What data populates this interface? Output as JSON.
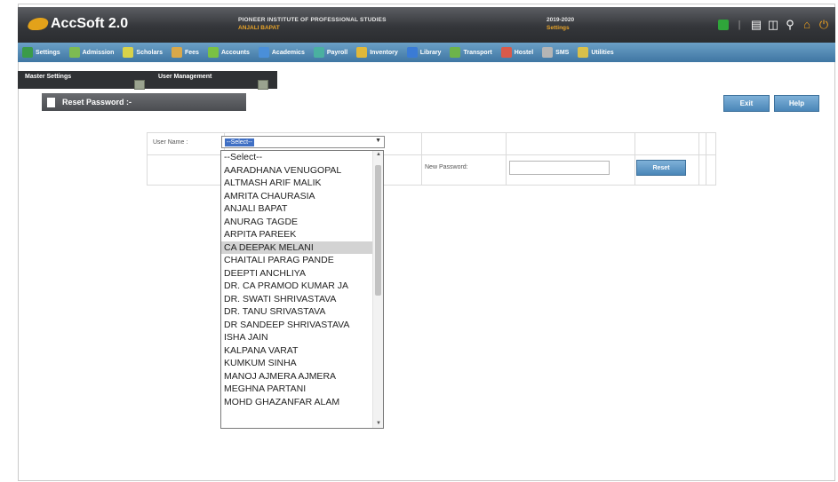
{
  "app": {
    "logo_text": "AccSoft 2.0",
    "institute_line1": "PIONEER INSTITUTE OF PROFESSIONAL STUDIES",
    "institute_line2": "ANJALI BAPAT",
    "session_line1": "2019-2020",
    "session_line2": "Settings"
  },
  "top_icons": [
    "status-green-icon",
    "separator-icon",
    "document-icon",
    "documents-icon",
    "key-icon",
    "home-icon",
    "power-icon"
  ],
  "menu": [
    {
      "label": "Settings",
      "icon": "settings-icon",
      "color": "#3b9b4a"
    },
    {
      "label": "Admission",
      "icon": "admission-icon",
      "color": "#7dbb52"
    },
    {
      "label": "Scholars",
      "icon": "scholars-icon",
      "color": "#d9d24a"
    },
    {
      "label": "Fees",
      "icon": "fees-icon",
      "color": "#d9a84a"
    },
    {
      "label": "Accounts",
      "icon": "accounts-icon",
      "color": "#7ac144"
    },
    {
      "label": "Academics",
      "icon": "academics-icon",
      "color": "#4a8fd9"
    },
    {
      "label": "Payroll",
      "icon": "payroll-icon",
      "color": "#4ab0a0"
    },
    {
      "label": "Inventory",
      "icon": "inventory-icon",
      "color": "#e0b83a"
    },
    {
      "label": "Library",
      "icon": "library-icon",
      "color": "#3a7bd5"
    },
    {
      "label": "Transport",
      "icon": "transport-icon",
      "color": "#6db34a"
    },
    {
      "label": "Hostel",
      "icon": "hostel-icon",
      "color": "#d95a4a"
    },
    {
      "label": "SMS",
      "icon": "sms-icon",
      "color": "#b5b5b5"
    },
    {
      "label": "Utilities",
      "icon": "utilities-icon",
      "color": "#d9c04a"
    }
  ],
  "submenu": {
    "master_settings": "Master Settings",
    "user_management": "User Management"
  },
  "panel": {
    "title": "Reset Password :-"
  },
  "buttons": {
    "exit": "Exit",
    "help": "Help",
    "reset": "Reset"
  },
  "form": {
    "username_label": "User Name :",
    "username_selected": "--Select--",
    "new_password_label": "New Password:",
    "new_password_value": ""
  },
  "dropdown": {
    "highlighted": "CA DEEPAK MELANI",
    "options": [
      "--Select--",
      "AARADHANA VENUGOPAL",
      "ALTMASH ARIF MALIK",
      "AMRITA CHAURASIA",
      "ANJALI BAPAT",
      "ANURAG TAGDE",
      "ARPITA PAREEK",
      "CA DEEPAK MELANI",
      "CHAITALI PARAG PANDE",
      "DEEPTI ANCHLIYA",
      "DR. CA PRAMOD KUMAR JA",
      "DR. SWATI SHRIVASTAVA",
      "DR. TANU SRIVASTAVA",
      "DR SANDEEP SHRIVASTAVA",
      "ISHA JAIN",
      "KALPANA VARAT",
      "KUMKUM SINHA",
      "MANOJ AJMERA AJMERA",
      "MEGHNA PARTANI",
      "MOHD GHAZANFAR ALAM"
    ]
  },
  "colors": {
    "topbar": "#34363a",
    "menubar": "#4f86b3",
    "accent_orange": "#e8a42a",
    "button_blue": "#5a95c4"
  }
}
